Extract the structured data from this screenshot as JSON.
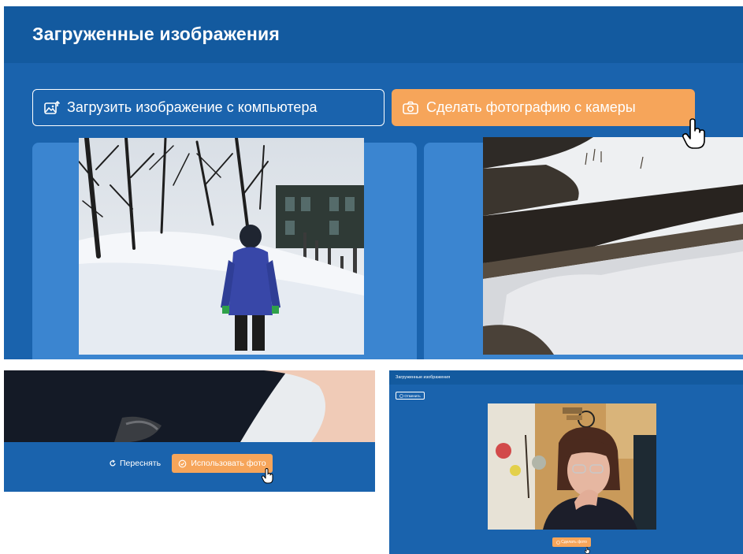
{
  "main": {
    "title": "Загруженные изображения",
    "upload_button": {
      "label": "Загрузить изображение с компьютера",
      "icon": "image-upload-icon"
    },
    "camera_button": {
      "label": "Сделать фотографию с камеры",
      "icon": "camera-icon"
    },
    "images": [
      {
        "name": "uploaded-image-winter-child"
      },
      {
        "name": "uploaded-image-snow-field"
      }
    ]
  },
  "review": {
    "retake_label": "Переснять",
    "retake_icon": "refresh-icon",
    "use_label": "Использовать фото",
    "use_icon": "check-circle-icon"
  },
  "camera_dialog": {
    "title": "Загруженные изображения",
    "cancel_label": "Отменить",
    "shot_label": "Сделать фото"
  },
  "colors": {
    "panel": "#1a63ad",
    "header": "#135a9f",
    "tile": "#3b85d0",
    "accent": "#f6a55a"
  }
}
